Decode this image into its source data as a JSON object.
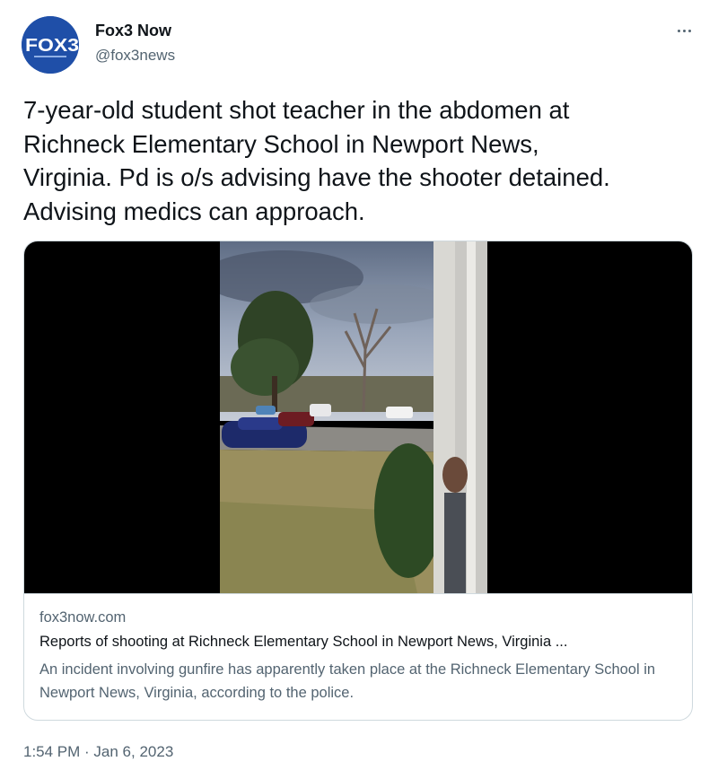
{
  "author": {
    "name": "Fox3 Now",
    "handle": "@fox3news",
    "avatar_text": "FOX3",
    "avatar_color": "#1f4fa8"
  },
  "tweet": {
    "text": "7-year-old student shot teacher in the abdomen at\nRichneck Elementary School in Newport News,\nVirginia. Pd is o/s advising have the shooter detained.\nAdvising medics can approach.",
    "timestamp": "1:54 PM · Jan 6, 2023"
  },
  "card": {
    "domain": "fox3now.com",
    "title": "Reports of shooting at Richneck Elementary School in Newport News, Virginia ...",
    "description": "An incident involving gunfire has apparently taken place at the Richneck Elementary School in Newport News, Virginia, according to the police."
  },
  "icons": {
    "more": "more-horizontal-icon"
  },
  "colors": {
    "text": "#0f1419",
    "secondary": "#536471",
    "border": "#cfd9de",
    "brand": "#1f4fa8"
  }
}
